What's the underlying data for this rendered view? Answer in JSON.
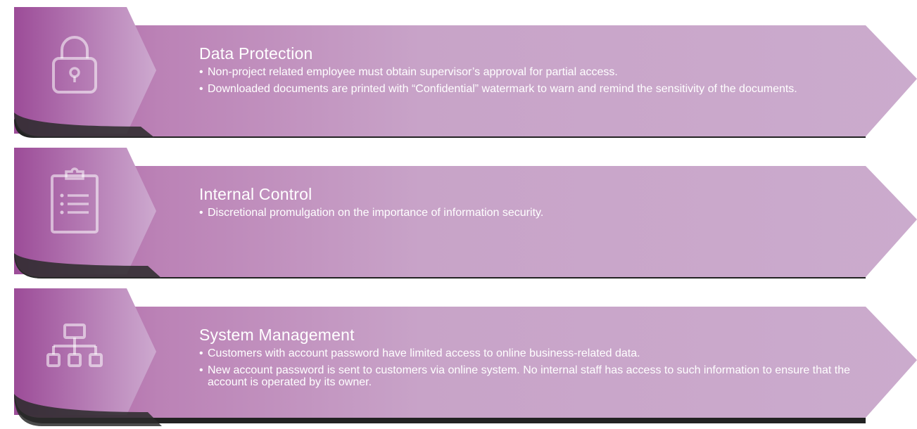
{
  "sections": [
    {
      "title": "Data Protection",
      "icon": "lock-icon",
      "bullets": [
        "Non-project related employee must obtain supervisor’s approval for partial access.",
        "Downloaded documents are printed with “Confidential” watermark to warn and remind the sensitivity of the documents."
      ]
    },
    {
      "title": "Internal Control",
      "icon": "clipboard-list-icon",
      "bullets": [
        "Discretional promulgation on the importance of information security."
      ]
    },
    {
      "title": "System Management",
      "icon": "hierarchy-icon",
      "bullets": [
        "Customers with account password have limited access to online business-related data.",
        "New account password is sent to customers via online system. No internal staff has access to such information to ensure that the account is operated by its owner."
      ]
    }
  ],
  "colors": {
    "panel_dark": "#8a3f8b",
    "panel_light": "#c9a5c9",
    "icon_panel": "#b07ab2",
    "shadow": "#1f1f1f",
    "text": "#ffffff"
  }
}
